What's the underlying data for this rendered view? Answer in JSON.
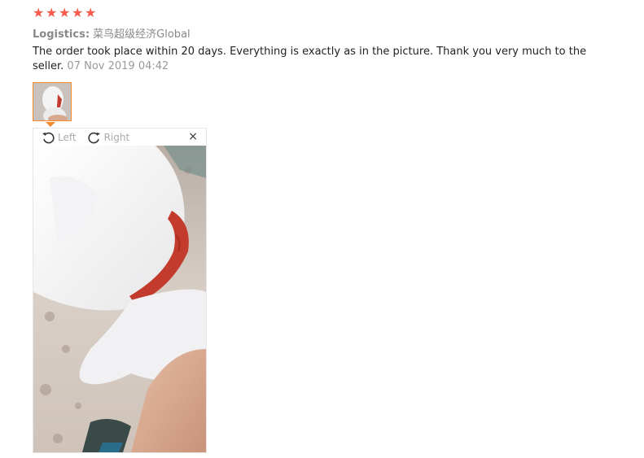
{
  "rating": {
    "stars": 5,
    "color": "#f25b4e"
  },
  "logistics": {
    "label": "Logistics:",
    "value": "菜鸟超级经济Global"
  },
  "review": {
    "text": "The order took place within 20 days. Everything is exactly as in the picture. Thank you very much to the seller.",
    "date": "07 Nov 2019 04:42"
  },
  "viewer": {
    "rotate_left_label": "Left",
    "rotate_right_label": "Right",
    "close_glyph": "×"
  }
}
